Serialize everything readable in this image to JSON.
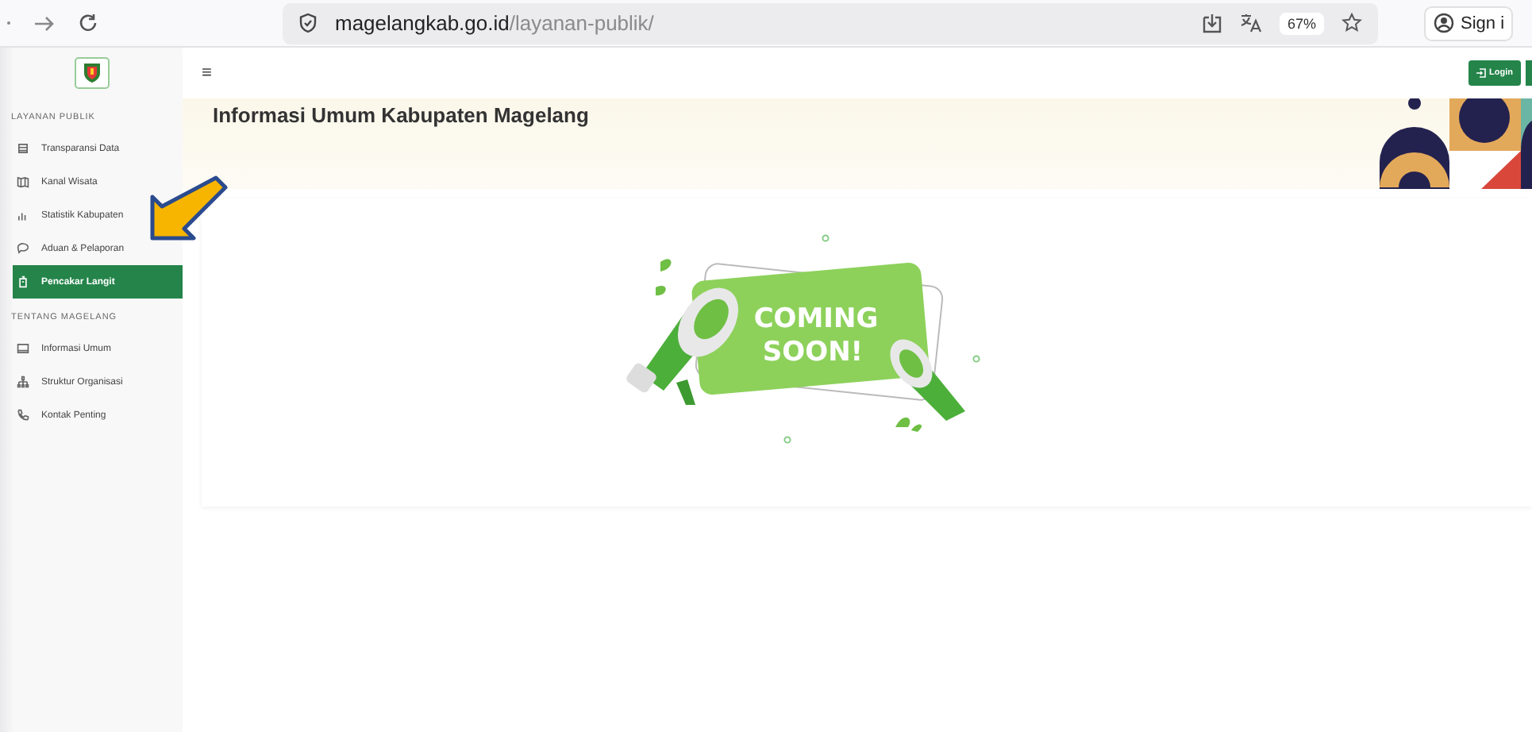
{
  "browser": {
    "url_host": "magelangkab.go.id",
    "url_path": "/layanan-publik/",
    "zoom": "67%",
    "profile_label": "Sign i"
  },
  "header": {
    "menu_glyph": "≡",
    "login_label": "Login"
  },
  "sidebar": {
    "sections": [
      {
        "heading": "LAYANAN PUBLIK",
        "items": [
          {
            "label": "Transparansi Data",
            "selected": false
          },
          {
            "label": "Kanal Wisata",
            "selected": false
          },
          {
            "label": "Statistik Kabupaten",
            "selected": false
          },
          {
            "label": "Aduan & Pelaporan",
            "selected": false
          },
          {
            "label": "Pencakar Langit",
            "selected": true
          }
        ]
      },
      {
        "heading": "TENTANG MAGELANG",
        "items": [
          {
            "label": "Informasi Umum",
            "selected": false
          },
          {
            "label": "Struktur Organisasi",
            "selected": false
          },
          {
            "label": "Kontak Penting",
            "selected": false
          }
        ]
      }
    ]
  },
  "banner": {
    "title": "Informasi Umum Kabupaten Magelang"
  },
  "content": {
    "announcement_lines": [
      "COMING",
      "SOON!"
    ]
  }
}
